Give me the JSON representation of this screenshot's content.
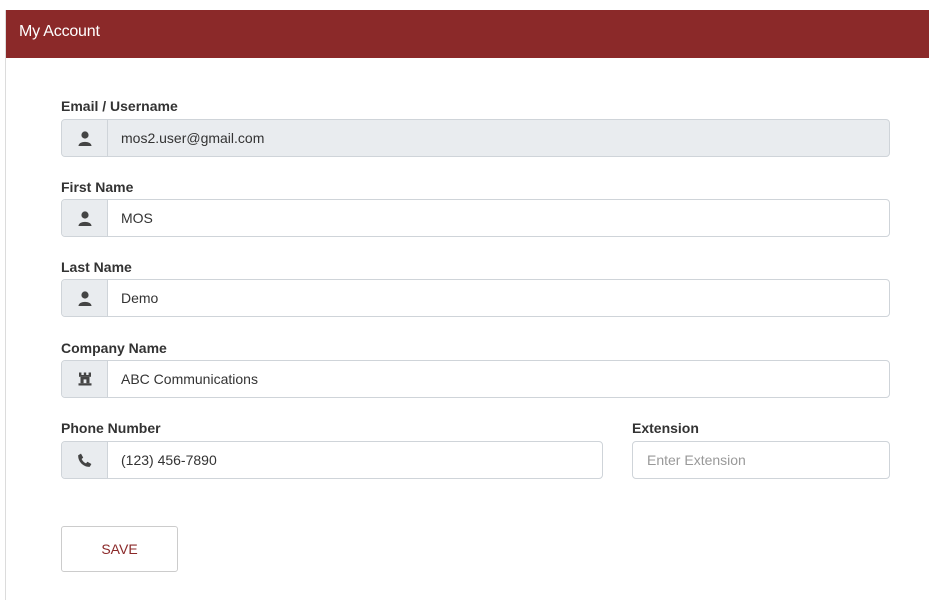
{
  "header": {
    "title": "My Account"
  },
  "fields": {
    "email": {
      "label": "Email / Username",
      "value": "mos2.user@gmail.com",
      "icon": "user-icon",
      "readonly": true
    },
    "first_name": {
      "label": "First Name",
      "value": "MOS",
      "icon": "user-icon"
    },
    "last_name": {
      "label": "Last Name",
      "value": "Demo",
      "icon": "user-icon"
    },
    "company": {
      "label": "Company Name",
      "value": "ABC Communications",
      "icon": "building-icon"
    },
    "phone": {
      "label": "Phone Number",
      "value": "(123) 456-7890",
      "icon": "phone-icon"
    },
    "extension": {
      "label": "Extension",
      "placeholder": "Enter Extension",
      "value": ""
    }
  },
  "actions": {
    "save_label": "SAVE"
  },
  "colors": {
    "header_bg": "#8b2929",
    "addon_bg": "#e9ecef",
    "accent_text": "#8b2929"
  }
}
